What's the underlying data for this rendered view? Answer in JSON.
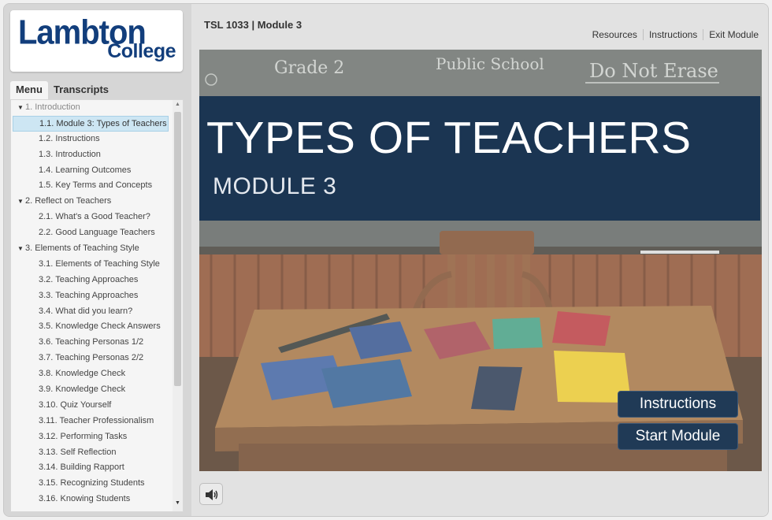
{
  "logo": {
    "line1": "Lambton",
    "line2": "College"
  },
  "sidebar": {
    "tabs": [
      {
        "label": "Menu",
        "active": true
      },
      {
        "label": "Transcripts",
        "active": false
      }
    ],
    "menu": [
      {
        "label": "1. Introduction",
        "type": "section"
      },
      {
        "label": "1.1. Module 3: Types of Teachers",
        "type": "sub",
        "selected": true
      },
      {
        "label": "1.2. Instructions",
        "type": "sub"
      },
      {
        "label": "1.3. Introduction",
        "type": "sub"
      },
      {
        "label": "1.4. Learning Outcomes",
        "type": "sub"
      },
      {
        "label": "1.5. Key Terms and Concepts",
        "type": "sub"
      },
      {
        "label": "2. Reflect on Teachers",
        "type": "section"
      },
      {
        "label": "2.1. What's a Good Teacher?",
        "type": "sub"
      },
      {
        "label": "2.2. Good Language Teachers",
        "type": "sub"
      },
      {
        "label": "3. Elements of Teaching Style",
        "type": "section"
      },
      {
        "label": "3.1. Elements of Teaching Style",
        "type": "sub"
      },
      {
        "label": "3.2. Teaching Approaches",
        "type": "sub"
      },
      {
        "label": "3.3. Teaching Approaches",
        "type": "sub"
      },
      {
        "label": "3.4. What did you learn?",
        "type": "sub"
      },
      {
        "label": "3.5. Knowledge Check Answers",
        "type": "sub"
      },
      {
        "label": "3.6. Teaching Personas 1/2",
        "type": "sub"
      },
      {
        "label": "3.7. Teaching Personas 2/2",
        "type": "sub"
      },
      {
        "label": "3.8. Knowledge Check",
        "type": "sub"
      },
      {
        "label": "3.9. Knowledge Check",
        "type": "sub"
      },
      {
        "label": "3.10. Quiz Yourself",
        "type": "sub"
      },
      {
        "label": "3.11. Teacher Professionalism",
        "type": "sub"
      },
      {
        "label": "3.12. Performing Tasks",
        "type": "sub"
      },
      {
        "label": "3.13. Self Reflection",
        "type": "sub"
      },
      {
        "label": "3.14. Building Rapport",
        "type": "sub"
      },
      {
        "label": "3.15. Recognizing Students",
        "type": "sub"
      },
      {
        "label": "3.16. Knowing Students",
        "type": "sub"
      }
    ]
  },
  "header": {
    "course_title": "TSL 1033 | Module 3",
    "links": [
      "Resources",
      "Instructions",
      "Exit Module"
    ]
  },
  "slide": {
    "chalkboard_words": [
      "Grade 2",
      "Public School",
      "Do Not Erase"
    ],
    "title": "TYPES OF TEACHERS",
    "subtitle": "MODULE 3",
    "instructions_button": "Instructions",
    "start_button": "Start Module"
  },
  "icons": {
    "audio": "speaker-icon",
    "caret": "caret-down-icon",
    "scroll_up": "scroll-up-icon",
    "scroll_down": "scroll-down-icon"
  },
  "colors": {
    "brand": "#123e7c",
    "title_panel": "#163250",
    "button": "#203a56",
    "selected_item": "#cde6f3"
  }
}
